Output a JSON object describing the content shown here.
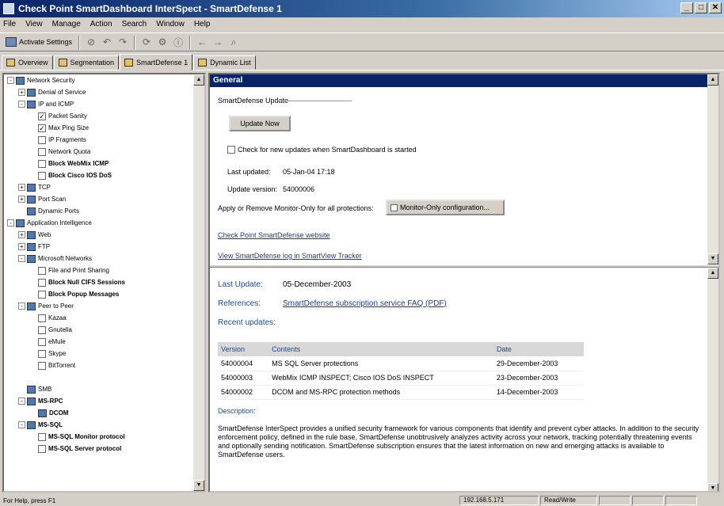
{
  "window": {
    "title": "Check Point SmartDashboard  InterSpect - SmartDefense 1",
    "controls": [
      "_",
      "□",
      "✕"
    ]
  },
  "menu": [
    "File",
    "View",
    "Manage",
    "Action",
    "Search",
    "Window",
    "Help"
  ],
  "toolbar": {
    "activate_label": "Activate Settings"
  },
  "tabs": [
    {
      "label": "Overview"
    },
    {
      "label": "Segmentation"
    },
    {
      "label": "SmartDefense 1"
    },
    {
      "label": "Dynamic List"
    }
  ],
  "tree": [
    {
      "lvl": 0,
      "exp": "-",
      "label": "Network Security",
      "bold": false
    },
    {
      "lvl": 1,
      "exp": "+",
      "label": "Denial of Service",
      "bold": false
    },
    {
      "lvl": 1,
      "exp": "-",
      "label": "IP and ICMP",
      "bold": false
    },
    {
      "lvl": 2,
      "chk": "✓",
      "label": "Packet Sanity",
      "bold": false
    },
    {
      "lvl": 2,
      "chk": "✓",
      "label": "Max Ping Size",
      "bold": false
    },
    {
      "lvl": 2,
      "chk": "",
      "label": "IP Fragments",
      "bold": false
    },
    {
      "lvl": 2,
      "chk": "",
      "label": "Network Quota",
      "bold": false
    },
    {
      "lvl": 2,
      "chk": "",
      "label": "Block WebMix ICMP",
      "bold": true
    },
    {
      "lvl": 2,
      "chk": "",
      "label": "Block Cisco IOS DoS",
      "bold": true
    },
    {
      "lvl": 1,
      "exp": "+",
      "label": "TCP",
      "bold": false
    },
    {
      "lvl": 1,
      "exp": "+",
      "label": "Port Scan",
      "bold": false
    },
    {
      "lvl": 1,
      "label": "Dynamic Ports",
      "bold": false
    },
    {
      "lvl": 0,
      "exp": "-",
      "label": "Application Intelligence",
      "bold": false
    },
    {
      "lvl": 1,
      "exp": "+",
      "label": "Web",
      "bold": false
    },
    {
      "lvl": 1,
      "exp": "+",
      "label": "FTP",
      "bold": false
    },
    {
      "lvl": 1,
      "exp": "-",
      "label": "Microsoft Networks",
      "bold": false
    },
    {
      "lvl": 2,
      "chk": "",
      "label": "File and Print Sharing",
      "bold": false
    },
    {
      "lvl": 2,
      "chk": "",
      "label": "Block Null CIFS Sessions",
      "bold": true
    },
    {
      "lvl": 2,
      "chk": "",
      "label": "Block Popup Messages",
      "bold": true
    },
    {
      "lvl": 1,
      "exp": "-",
      "label": "Peer to Peer",
      "bold": false
    },
    {
      "lvl": 2,
      "chk": "",
      "label": "Kazaa",
      "bold": false
    },
    {
      "lvl": 2,
      "chk": "",
      "label": "Gnutella",
      "bold": false
    },
    {
      "lvl": 2,
      "chk": "",
      "label": "eMule",
      "bold": false
    },
    {
      "lvl": 2,
      "chk": "",
      "label": "Skype",
      "bold": false
    },
    {
      "lvl": 2,
      "chk": "",
      "label": "BitTorrent",
      "bold": false
    },
    {
      "lvl": 1,
      "label": "",
      "bold": false
    },
    {
      "lvl": 1,
      "label": "SMB",
      "bold": false
    },
    {
      "lvl": 1,
      "exp": "-",
      "label": "MS-RPC",
      "bold": true
    },
    {
      "lvl": 2,
      "label": "DCOM",
      "bold": true
    },
    {
      "lvl": 1,
      "exp": "-",
      "label": "MS-SQL",
      "bold": true
    },
    {
      "lvl": 2,
      "chk": "",
      "label": "MS-SQL Monitor protocol",
      "bold": true
    },
    {
      "lvl": 2,
      "chk": "",
      "label": "MS-SQL Server protocol",
      "bold": true
    }
  ],
  "general": {
    "header": "General",
    "help": "?",
    "group_title": "SmartDefense Update",
    "update_button": "Update Now",
    "auto_check_label": "Check for new updates when SmartDashboard is started",
    "last_updated_label": "Last updated:",
    "last_updated_value": "05-Jan-04 17:18",
    "update_version_label": "Update version:",
    "update_version_value": "54000006",
    "monitor_text": "Apply or Remove Monitor-Only for all protections:",
    "monitor_button": "Monitor-Only configuration...",
    "link1": "Check Point SmartDefense website",
    "link2": "View SmartDefense log in SmartView Tracker"
  },
  "lower": {
    "last_update_label": "Last Update:",
    "last_update_value": "05-December-2003",
    "references_label": "References:",
    "references_link": "SmartDefense subscription service FAQ (PDF)",
    "recent_label": "Recent updates:",
    "table_headers": [
      "Version",
      "Contents",
      "Date"
    ],
    "rows": [
      [
        "54000004",
        "MS SQL Server protections",
        "29-December-2003"
      ],
      [
        "54000003",
        "WebMix ICMP INSPECT; Cisco IOS DoS INSPECT",
        "23-December-2003"
      ],
      [
        "54000002",
        "DCOM and MS-RPC protection methods",
        "14-December-2003"
      ]
    ],
    "description_label": "Description:",
    "description": "SmartDefense InterSpect provides a unified security framework for various components that identify and prevent cyber attacks. In addition to the security enforcement policy, defined in the rule base, SmartDefense unobtrusively analyzes activity across your network, tracking potentially threatening events and optionally sending notification. SmartDefense subscription ensures that the latest information on new and emerging attacks is available to SmartDefense users."
  },
  "status": {
    "help": "For Help, press F1",
    "ip": "192.168.5.171",
    "state": "Read/Write"
  }
}
